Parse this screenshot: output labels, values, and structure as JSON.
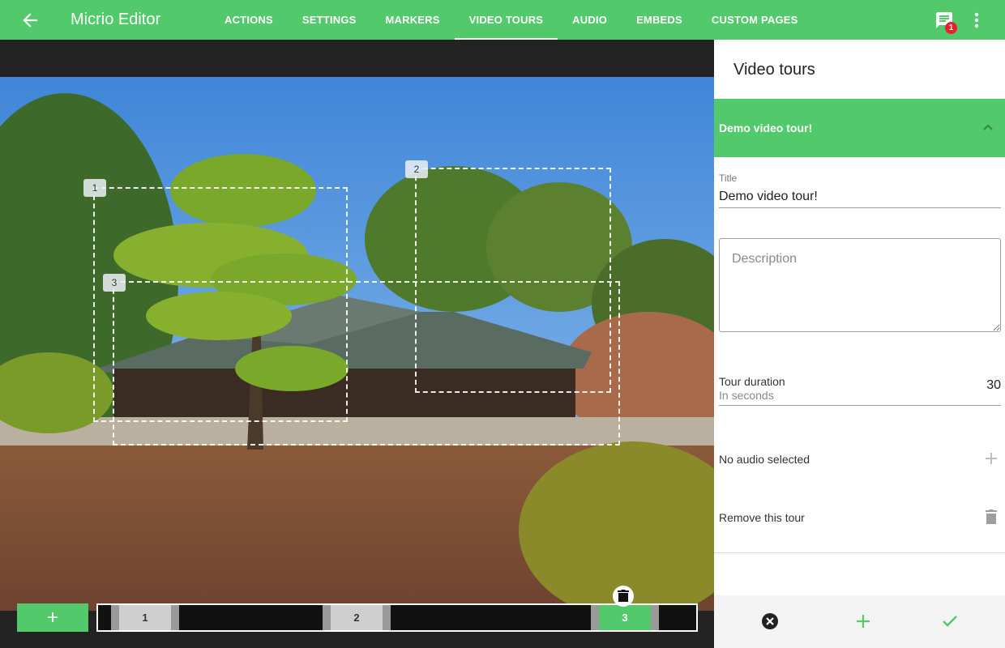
{
  "header": {
    "app_title": "Micrio Editor",
    "tabs": [
      {
        "label": "ACTIONS"
      },
      {
        "label": "SETTINGS"
      },
      {
        "label": "MARKERS"
      },
      {
        "label": "VIDEO TOURS",
        "active": true
      },
      {
        "label": "AUDIO"
      },
      {
        "label": "EMBEDS"
      },
      {
        "label": "CUSTOM PAGES"
      }
    ],
    "notification_count": "1",
    "accent_color": "#52c96a"
  },
  "canvas": {
    "viewports": [
      {
        "label": "1"
      },
      {
        "label": "2"
      },
      {
        "label": "3"
      }
    ],
    "add_button_label": "+",
    "timeline": [
      {
        "label": "1",
        "selected": false
      },
      {
        "label": "2",
        "selected": false
      },
      {
        "label": "3",
        "selected": true
      }
    ]
  },
  "panel": {
    "title": "Video tours",
    "tour": {
      "name": "Demo video tour!",
      "title_label": "Title",
      "title_value": "Demo video tour!",
      "description_placeholder": "Description",
      "duration_label": "Tour duration",
      "duration_sub": "In seconds",
      "duration_value": "30",
      "audio_text": "No audio selected",
      "remove_text": "Remove this tour"
    }
  }
}
